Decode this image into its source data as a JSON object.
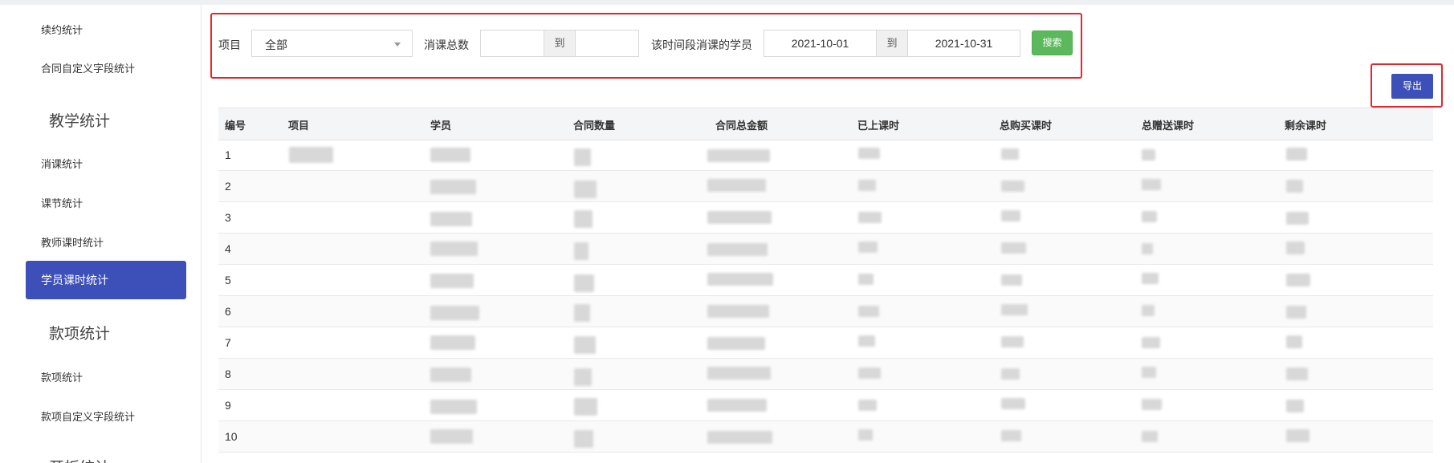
{
  "sidebar": {
    "items_top": [
      "续约统计",
      "合同自定义字段统计"
    ],
    "section_teaching": "教学统计",
    "items_teaching": [
      "消课统计",
      "课节统计",
      "教师课时统计"
    ],
    "active_item": "学员课时统计",
    "section_payment": "款项统计",
    "items_payment": [
      "款项统计",
      "款项自定义字段统计"
    ],
    "section_partial": "开板统计"
  },
  "filter": {
    "project_label": "项目",
    "project_value": "全部",
    "consume_label": "消课总数",
    "to": "到",
    "period_label": "该时间段消课的学员",
    "date_from": "2021-10-01",
    "date_to": "2021-10-31",
    "search_button": "搜索"
  },
  "export_button": "导出",
  "table": {
    "columns": [
      "编号",
      "项目",
      "学员",
      "合同数量",
      "合同总金额",
      "已上课时",
      "总购买课时",
      "总赠送课时",
      "剩余课时"
    ],
    "row_ids": [
      "1",
      "2",
      "3",
      "4",
      "5",
      "6",
      "7",
      "8",
      "9",
      "10"
    ]
  },
  "colors": {
    "accent": "#3d4fb8",
    "search": "#5cb85c",
    "highlight": "#e8242b"
  }
}
